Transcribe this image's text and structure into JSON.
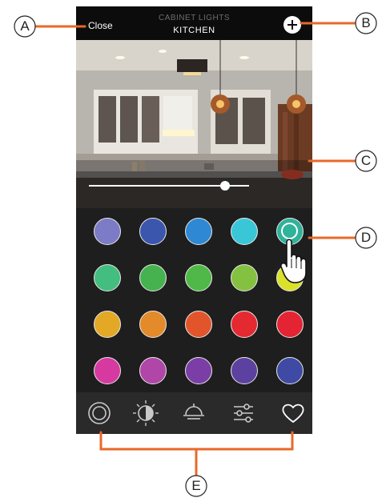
{
  "header": {
    "close_label": "Close",
    "subtitle": "CABINET LIGHTS",
    "title": "KITCHEN",
    "add_icon": "plus-icon"
  },
  "brightness": {
    "level": 0.85
  },
  "palette": {
    "selected_index": 4,
    "rows": [
      [
        "#7b7bc6",
        "#3b56ad",
        "#2e88d4",
        "#39c7d8",
        "#2fb39a"
      ],
      [
        "#44bd80",
        "#45b24f",
        "#4fb848",
        "#85c140",
        "#d9e12b"
      ],
      [
        "#e2a826",
        "#e38a2a",
        "#e2552a",
        "#e42a30",
        "#e42433"
      ],
      [
        "#d63aa0",
        "#b046a7",
        "#7b3ea6",
        "#5c41a0",
        "#3f4aa5"
      ]
    ]
  },
  "tabs": [
    {
      "icon": "color-wheel-icon"
    },
    {
      "icon": "brightness-sun-icon"
    },
    {
      "icon": "lamp-icon"
    },
    {
      "icon": "sliders-icon"
    },
    {
      "icon": "heart-icon"
    }
  ],
  "callouts": {
    "a": "A",
    "b": "B",
    "c": "C",
    "d": "D",
    "e": "E"
  },
  "colors": {
    "callout": "#e8692a",
    "background": "#161616",
    "header": "#0c0c0c"
  }
}
